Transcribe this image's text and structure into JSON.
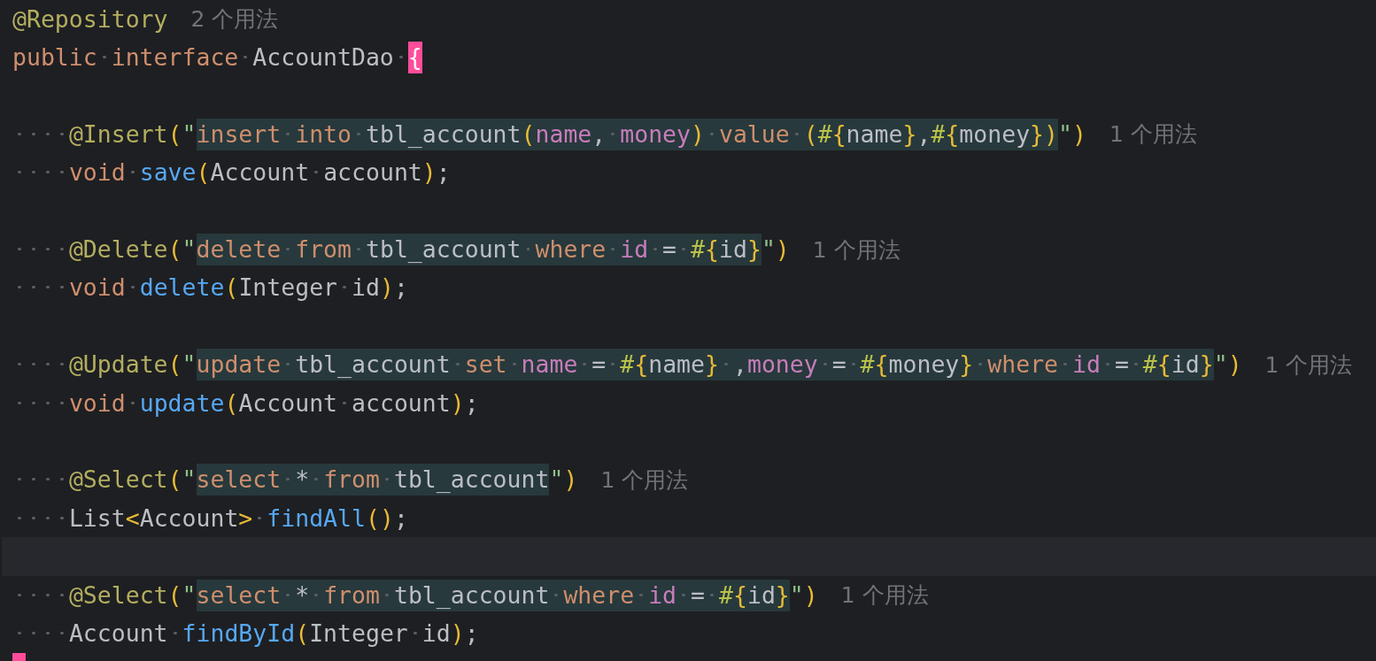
{
  "editor": {
    "lines": [
      {
        "kind": "code",
        "tokens": [
          {
            "kind": "ann",
            "text": "@Repository"
          }
        ],
        "hint": "2 个用法"
      },
      {
        "kind": "code",
        "tokens": [
          {
            "kind": "kw",
            "text": "public interface "
          },
          {
            "kind": "type",
            "text": "AccountDao "
          },
          {
            "kind": "brace-match",
            "text": "{"
          }
        ]
      },
      {
        "kind": "blank"
      },
      {
        "kind": "code",
        "tokens": [
          {
            "kind": "ann",
            "text": "    @Insert"
          },
          {
            "kind": "paren",
            "text": "("
          },
          {
            "kind": "quote",
            "text": "\""
          },
          {
            "kind": "skw",
            "text": "insert into "
          },
          {
            "kind": "sid",
            "text": "tbl_account"
          },
          {
            "kind": "sparen",
            "text": "("
          },
          {
            "kind": "scol",
            "text": "name"
          },
          {
            "kind": "sid",
            "text": ", "
          },
          {
            "kind": "scol",
            "text": "money"
          },
          {
            "kind": "sparen",
            "text": ")"
          },
          {
            "kind": "skw",
            "text": " value "
          },
          {
            "kind": "sparen",
            "text": "("
          },
          {
            "kind": "shash",
            "text": "#"
          },
          {
            "kind": "sparen",
            "text": "{"
          },
          {
            "kind": "sid",
            "text": "name"
          },
          {
            "kind": "sparen",
            "text": "}"
          },
          {
            "kind": "sid",
            "text": ","
          },
          {
            "kind": "shash",
            "text": "#"
          },
          {
            "kind": "sparen",
            "text": "{"
          },
          {
            "kind": "sid",
            "text": "money"
          },
          {
            "kind": "sparen",
            "text": "})"
          },
          {
            "kind": "quote",
            "text": "\""
          },
          {
            "kind": "paren",
            "text": ")"
          }
        ],
        "hint": "1 个用法"
      },
      {
        "kind": "code",
        "tokens": [
          {
            "kind": "kw",
            "text": "    void "
          },
          {
            "kind": "method",
            "text": "save"
          },
          {
            "kind": "paren",
            "text": "("
          },
          {
            "kind": "type",
            "text": "Account account"
          },
          {
            "kind": "paren",
            "text": ")"
          },
          {
            "kind": "type",
            "text": ";"
          }
        ]
      },
      {
        "kind": "blank"
      },
      {
        "kind": "code",
        "tokens": [
          {
            "kind": "ann",
            "text": "    @Delete"
          },
          {
            "kind": "paren",
            "text": "("
          },
          {
            "kind": "quote",
            "text": "\""
          },
          {
            "kind": "skw",
            "text": "delete from "
          },
          {
            "kind": "sid",
            "text": "tbl_account "
          },
          {
            "kind": "skw",
            "text": "where "
          },
          {
            "kind": "scol",
            "text": "id"
          },
          {
            "kind": "sid",
            "text": " = "
          },
          {
            "kind": "shash",
            "text": "#"
          },
          {
            "kind": "sparen",
            "text": "{"
          },
          {
            "kind": "sid",
            "text": "id"
          },
          {
            "kind": "sparen",
            "text": "}"
          },
          {
            "kind": "quote",
            "text": "\""
          },
          {
            "kind": "paren",
            "text": ")"
          }
        ],
        "hint": "1 个用法"
      },
      {
        "kind": "code",
        "tokens": [
          {
            "kind": "kw",
            "text": "    void "
          },
          {
            "kind": "method",
            "text": "delete"
          },
          {
            "kind": "paren",
            "text": "("
          },
          {
            "kind": "type",
            "text": "Integer id"
          },
          {
            "kind": "paren",
            "text": ")"
          },
          {
            "kind": "type",
            "text": ";"
          }
        ]
      },
      {
        "kind": "blank"
      },
      {
        "kind": "code",
        "tokens": [
          {
            "kind": "ann",
            "text": "    @Update"
          },
          {
            "kind": "paren",
            "text": "("
          },
          {
            "kind": "quote",
            "text": "\""
          },
          {
            "kind": "skw",
            "text": "update "
          },
          {
            "kind": "sid",
            "text": "tbl_account "
          },
          {
            "kind": "skw",
            "text": "set "
          },
          {
            "kind": "scol",
            "text": "name"
          },
          {
            "kind": "sid",
            "text": " = "
          },
          {
            "kind": "shash",
            "text": "#"
          },
          {
            "kind": "sparen",
            "text": "{"
          },
          {
            "kind": "sid",
            "text": "name"
          },
          {
            "kind": "sparen",
            "text": "}"
          },
          {
            "kind": "sid",
            "text": " ,"
          },
          {
            "kind": "scol",
            "text": "money"
          },
          {
            "kind": "sid",
            "text": " = "
          },
          {
            "kind": "shash",
            "text": "#"
          },
          {
            "kind": "sparen",
            "text": "{"
          },
          {
            "kind": "sid",
            "text": "money"
          },
          {
            "kind": "sparen",
            "text": "}"
          },
          {
            "kind": "skw",
            "text": " where "
          },
          {
            "kind": "scol",
            "text": "id"
          },
          {
            "kind": "sid",
            "text": " = "
          },
          {
            "kind": "shash",
            "text": "#"
          },
          {
            "kind": "sparen",
            "text": "{"
          },
          {
            "kind": "sid",
            "text": "id"
          },
          {
            "kind": "sparen",
            "text": "}"
          },
          {
            "kind": "quote",
            "text": "\""
          },
          {
            "kind": "paren",
            "text": ")"
          }
        ],
        "hint": "1 个用法"
      },
      {
        "kind": "code",
        "tokens": [
          {
            "kind": "kw",
            "text": "    void "
          },
          {
            "kind": "method",
            "text": "update"
          },
          {
            "kind": "paren",
            "text": "("
          },
          {
            "kind": "type",
            "text": "Account account"
          },
          {
            "kind": "paren",
            "text": ")"
          },
          {
            "kind": "type",
            "text": ";"
          }
        ]
      },
      {
        "kind": "blank"
      },
      {
        "kind": "code",
        "tokens": [
          {
            "kind": "ann",
            "text": "    @Select"
          },
          {
            "kind": "paren",
            "text": "("
          },
          {
            "kind": "quote",
            "text": "\""
          },
          {
            "kind": "skw",
            "text": "select "
          },
          {
            "kind": "sid",
            "text": "* "
          },
          {
            "kind": "skw",
            "text": "from "
          },
          {
            "kind": "sid",
            "text": "tbl_account"
          },
          {
            "kind": "quote",
            "text": "\""
          },
          {
            "kind": "paren",
            "text": ")"
          }
        ],
        "hint": "1 个用法"
      },
      {
        "kind": "code",
        "tokens": [
          {
            "kind": "type",
            "text": "    List"
          },
          {
            "kind": "paren",
            "text": "<"
          },
          {
            "kind": "type",
            "text": "Account"
          },
          {
            "kind": "paren",
            "text": "> "
          },
          {
            "kind": "method",
            "text": "findAll"
          },
          {
            "kind": "paren",
            "text": "()"
          },
          {
            "kind": "type",
            "text": ";"
          }
        ]
      },
      {
        "kind": "current"
      },
      {
        "kind": "code",
        "tokens": [
          {
            "kind": "ann",
            "text": "    @Select"
          },
          {
            "kind": "paren",
            "text": "("
          },
          {
            "kind": "quote",
            "text": "\""
          },
          {
            "kind": "skw",
            "text": "select "
          },
          {
            "kind": "sid",
            "text": "* "
          },
          {
            "kind": "skw",
            "text": "from "
          },
          {
            "kind": "sid",
            "text": "tbl_account "
          },
          {
            "kind": "skw",
            "text": "where "
          },
          {
            "kind": "scol",
            "text": "id"
          },
          {
            "kind": "sid",
            "text": " = "
          },
          {
            "kind": "shash",
            "text": "#"
          },
          {
            "kind": "sparen",
            "text": "{"
          },
          {
            "kind": "sid",
            "text": "id"
          },
          {
            "kind": "sparen",
            "text": "}"
          },
          {
            "kind": "quote",
            "text": "\""
          },
          {
            "kind": "paren",
            "text": ")"
          }
        ],
        "hint": "1 个用法"
      },
      {
        "kind": "code",
        "tokens": [
          {
            "kind": "type",
            "text": "    Account "
          },
          {
            "kind": "method",
            "text": "findById"
          },
          {
            "kind": "paren",
            "text": "("
          },
          {
            "kind": "type",
            "text": "Integer id"
          },
          {
            "kind": "paren",
            "text": ")"
          },
          {
            "kind": "type",
            "text": ";"
          }
        ]
      }
    ]
  }
}
